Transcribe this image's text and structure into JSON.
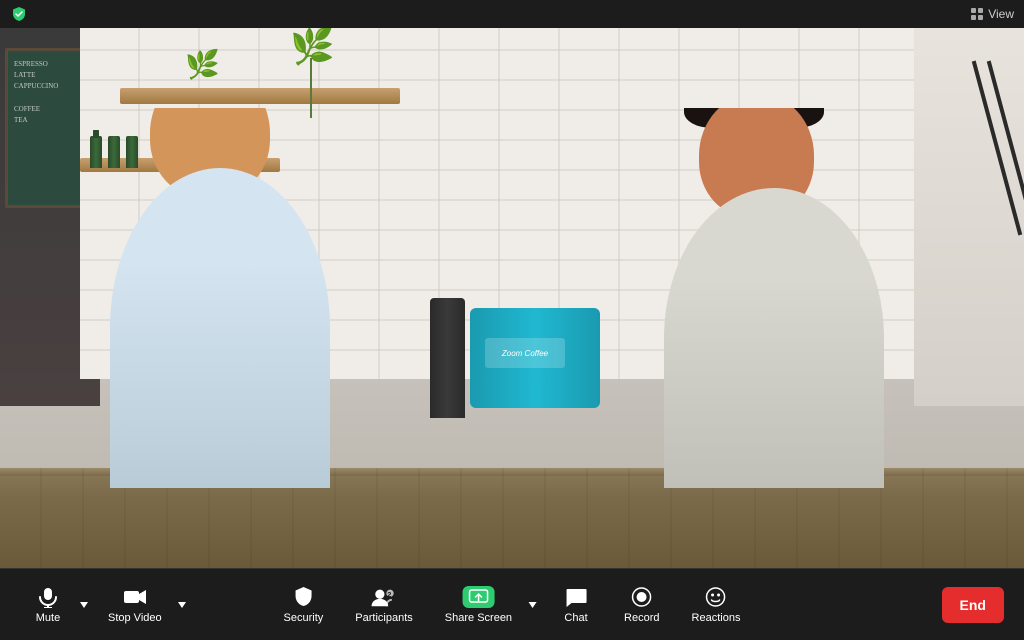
{
  "topbar": {
    "view_label": "View",
    "shield_color": "#2ecc71"
  },
  "toolbar": {
    "mute_label": "Mute",
    "stop_video_label": "Stop Video",
    "security_label": "Security",
    "participants_label": "Participants",
    "participants_count": "2",
    "share_screen_label": "Share Screen",
    "chat_label": "Chat",
    "record_label": "Record",
    "reactions_label": "Reactions",
    "end_label": "End"
  },
  "video": {
    "bg_desc": "Two people in a coffee shop setting"
  }
}
